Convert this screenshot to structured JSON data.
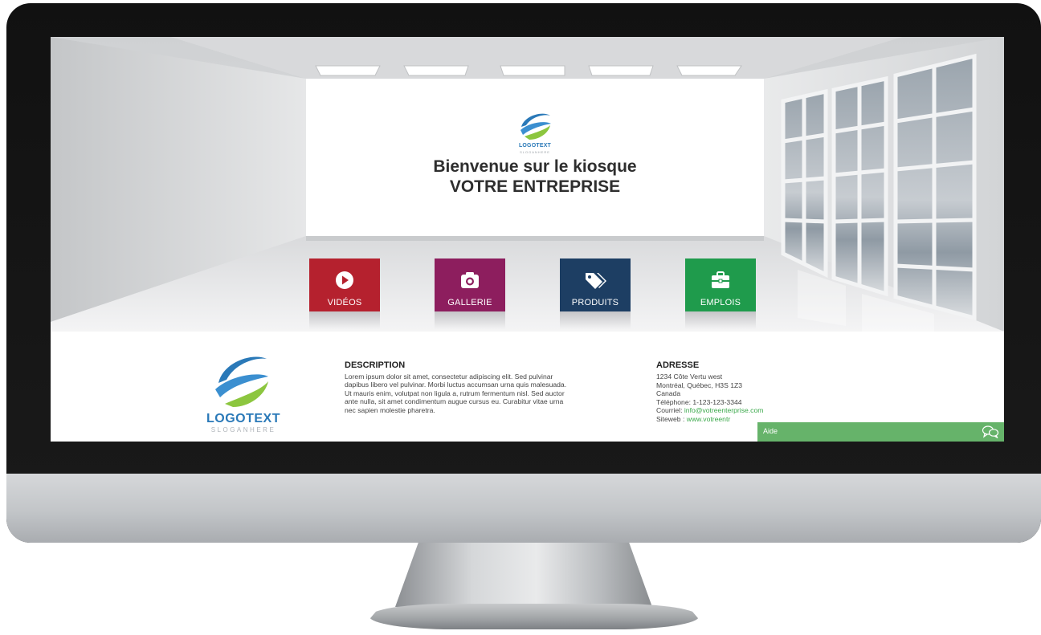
{
  "welcome": {
    "brand": "LOGOTEXT",
    "brand_slogan": "SLOGANHERE",
    "line1": "Bienvenue sur le kiosque",
    "line2": "VOTRE ENTREPRISE"
  },
  "tiles": [
    {
      "label": "VIDÉOS",
      "color": "#b5212e",
      "icon": "play-icon"
    },
    {
      "label": "GALLERIE",
      "color": "#8d1e5e",
      "icon": "camera-icon"
    },
    {
      "label": "PRODUITS",
      "color": "#1d3e63",
      "icon": "tag-icon"
    },
    {
      "label": "EMPLOIS",
      "color": "#1f9b4c",
      "icon": "briefcase-icon"
    }
  ],
  "footer": {
    "logo_word": "LOGOTEXT",
    "logo_slogan": "SLOGANHERE",
    "description": {
      "title": "DESCRIPTION",
      "body": "Lorem ipsum dolor sit amet, consectetur adipiscing elit. Sed pulvinar dapibus libero vel pulvinar. Morbi luctus accumsan urna quis malesuada. Ut mauris enim, volutpat non ligula a, rutrum fermentum nisl. Sed auctor ante nulla, sit amet condimentum augue cursus eu. Curabitur vitae urna nec sapien molestie pharetra."
    },
    "address": {
      "title": "ADRESSE",
      "street": "1234 Côte Vertu west",
      "city": "Montréal, Québec, H3S 1Z3",
      "country": "Canada",
      "phone": "Téléphone: 1-123-123-3344",
      "email_label": "Courriel: ",
      "email": "info@votreenterprise.com",
      "site_label": "Siteweb : ",
      "site": "www.votreentr"
    }
  },
  "help": {
    "label": "Aide",
    "icon": "chat-bubbles-icon"
  },
  "colors": {
    "accent_green": "#66b36a",
    "brand_blue": "#2a79b8"
  }
}
